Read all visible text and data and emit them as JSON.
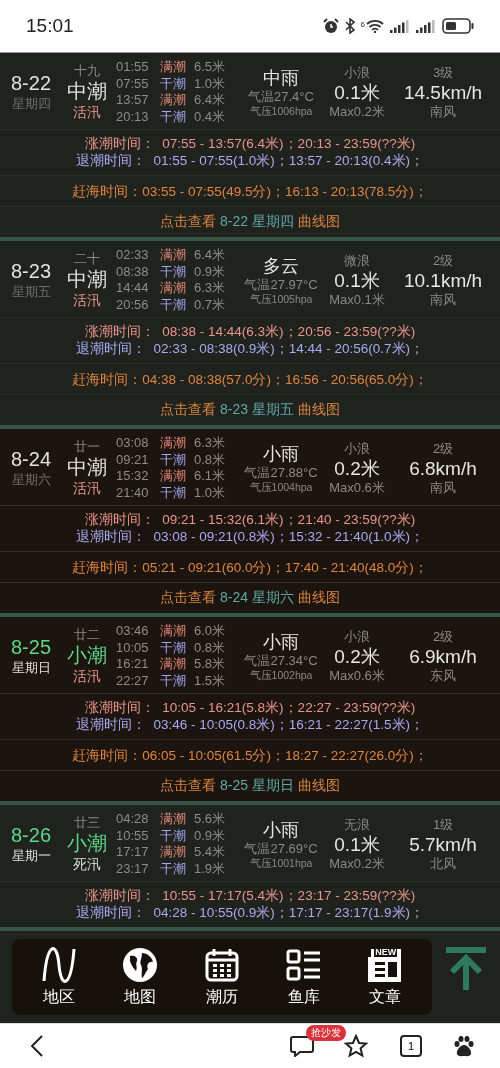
{
  "status_bar": {
    "time": "15:01",
    "network": "6"
  },
  "days": [
    {
      "date": "8-22",
      "weekday": "星期四",
      "weekend": false,
      "lunar": "十九",
      "tide": {
        "name": "中潮",
        "kind": "medium"
      },
      "period": {
        "label": "活汛",
        "kind": "active"
      },
      "tides": [
        {
          "time": "01:55",
          "kind": "high",
          "label": "满潮",
          "height": "6.5米"
        },
        {
          "time": "07:55",
          "kind": "low",
          "label": "干潮",
          "height": "1.0米"
        },
        {
          "time": "13:57",
          "kind": "high",
          "label": "满潮",
          "height": "6.4米"
        },
        {
          "time": "20:13",
          "kind": "low",
          "label": "干潮",
          "height": "0.4米"
        }
      ],
      "weather": "中雨",
      "temperature": "气温27.4°C",
      "pressure": "气压1006hpa",
      "wave_name": "小浪",
      "wave": "0.1米",
      "wave_max": "Max0.2米",
      "wind_level": "3级",
      "wind_speed": "14.5km/h",
      "wind_dir": "南风",
      "rising": "涨潮时间：  07:55 - 13:57(6.4米)；20:13 - 23:59(??米)",
      "falling": "退潮时间：  01:55 - 07:55(1.0米)；13:57 - 20:13(0.4米)；",
      "catch": "赶海时间：03:55 - 07:55(49.5分)；16:13 - 20:13(78.5分)；",
      "link": {
        "prefix": "点击查看",
        "target": "8-22 星期四",
        "suffix": "曲线图"
      }
    },
    {
      "date": "8-23",
      "weekday": "星期五",
      "weekend": false,
      "lunar": "二十",
      "tide": {
        "name": "中潮",
        "kind": "medium"
      },
      "period": {
        "label": "活汛",
        "kind": "active"
      },
      "tides": [
        {
          "time": "02:33",
          "kind": "high",
          "label": "满潮",
          "height": "6.4米"
        },
        {
          "time": "08:38",
          "kind": "low",
          "label": "干潮",
          "height": "0.9米"
        },
        {
          "time": "14:44",
          "kind": "high",
          "label": "满潮",
          "height": "6.3米"
        },
        {
          "time": "20:56",
          "kind": "low",
          "label": "干潮",
          "height": "0.7米"
        }
      ],
      "weather": "多云",
      "temperature": "气温27.97°C",
      "pressure": "气压1005hpa",
      "wave_name": "微浪",
      "wave": "0.1米",
      "wave_max": "Max0.1米",
      "wind_level": "2级",
      "wind_speed": "10.1km/h",
      "wind_dir": "南风",
      "rising": "涨潮时间：  08:38 - 14:44(6.3米)；20:56 - 23:59(??米)",
      "falling": "退潮时间：  02:33 - 08:38(0.9米)；14:44 - 20:56(0.7米)；",
      "catch": "赶海时间：04:38 - 08:38(57.0分)；16:56 - 20:56(65.0分)；",
      "link": {
        "prefix": "点击查看",
        "target": "8-23 星期五",
        "suffix": "曲线图"
      }
    },
    {
      "date": "8-24",
      "weekday": "星期六",
      "weekend": true,
      "lunar": "廿一",
      "tide": {
        "name": "中潮",
        "kind": "medium"
      },
      "period": {
        "label": "活汛",
        "kind": "active"
      },
      "tides": [
        {
          "time": "03:08",
          "kind": "high",
          "label": "满潮",
          "height": "6.3米"
        },
        {
          "time": "09:21",
          "kind": "low",
          "label": "干潮",
          "height": "0.8米"
        },
        {
          "time": "15:32",
          "kind": "high",
          "label": "满潮",
          "height": "6.1米"
        },
        {
          "time": "21:40",
          "kind": "low",
          "label": "干潮",
          "height": "1.0米"
        }
      ],
      "weather": "小雨",
      "temperature": "气温27.88°C",
      "pressure": "气压1004hpa",
      "wave_name": "小浪",
      "wave": "0.2米",
      "wave_max": "Max0.6米",
      "wind_level": "2级",
      "wind_speed": "6.8km/h",
      "wind_dir": "南风",
      "rising": "涨潮时间：  09:21 - 15:32(6.1米)；21:40 - 23:59(??米)",
      "falling": "退潮时间：  03:08 - 09:21(0.8米)；15:32 - 21:40(1.0米)；",
      "catch": "赶海时间：05:21 - 09:21(60.0分)；17:40 - 21:40(48.0分)；",
      "link": {
        "prefix": "点击查看",
        "target": "8-24 星期六",
        "suffix": "曲线图"
      }
    },
    {
      "date": "8-25",
      "weekday": "星期日",
      "weekend": true,
      "lunar": "廿二",
      "tide": {
        "name": "小潮",
        "kind": "small"
      },
      "period": {
        "label": "活汛",
        "kind": "active"
      },
      "tides": [
        {
          "time": "03:46",
          "kind": "high",
          "label": "满潮",
          "height": "6.0米"
        },
        {
          "time": "10:05",
          "kind": "low",
          "label": "干潮",
          "height": "0.8米"
        },
        {
          "time": "16:21",
          "kind": "high",
          "label": "满潮",
          "height": "5.8米"
        },
        {
          "time": "22:27",
          "kind": "low",
          "label": "干潮",
          "height": "1.5米"
        }
      ],
      "weather": "小雨",
      "temperature": "气温27.34°C",
      "pressure": "气压1002hpa",
      "wave_name": "小浪",
      "wave": "0.2米",
      "wave_max": "Max0.6米",
      "wind_level": "2级",
      "wind_speed": "6.9km/h",
      "wind_dir": "东风",
      "rising": "涨潮时间：  10:05 - 16:21(5.8米)；22:27 - 23:59(??米)",
      "falling": "退潮时间：  03:46 - 10:05(0.8米)；16:21 - 22:27(1.5米)；",
      "catch": "赶海时间：06:05 - 10:05(61.5分)；18:27 - 22:27(26.0分)；",
      "link": {
        "prefix": "点击查看",
        "target": "8-25 星期日",
        "suffix": "曲线图"
      }
    },
    {
      "date": "8-26",
      "weekday": "星期一",
      "weekend": false,
      "lunar": "廿三",
      "tide": {
        "name": "小潮",
        "kind": "small"
      },
      "period": {
        "label": "死汛",
        "kind": "dead"
      },
      "tides": [
        {
          "time": "04:28",
          "kind": "high",
          "label": "满潮",
          "height": "5.6米"
        },
        {
          "time": "10:55",
          "kind": "low",
          "label": "干潮",
          "height": "0.9米"
        },
        {
          "time": "17:17",
          "kind": "high",
          "label": "满潮",
          "height": "5.4米"
        },
        {
          "time": "23:17",
          "kind": "low",
          "label": "干潮",
          "height": "1.9米"
        }
      ],
      "weather": "小雨",
      "temperature": "气温27.69°C",
      "pressure": "气压1001hpa",
      "wave_name": "无浪",
      "wave": "0.1米",
      "wave_max": "Max0.2米",
      "wind_level": "1级",
      "wind_speed": "5.7km/h",
      "wind_dir": "北风",
      "rising": "涨潮时间：  10:55 - 17:17(5.4米)；23:17 - 23:59(??米)",
      "falling": "退潮时间：  04:28 - 10:55(0.9米)；17:17 - 23:17(1.9米)；"
    }
  ],
  "nav": [
    {
      "kind": "wave",
      "label": "地区"
    },
    {
      "kind": "globe",
      "label": "地图"
    },
    {
      "kind": "calendar",
      "label": "潮历"
    },
    {
      "kind": "list",
      "label": "鱼库"
    },
    {
      "kind": "news",
      "label": "文章",
      "badge": "NEW"
    }
  ],
  "browser_bar": {
    "comment_badge": "抢沙发",
    "tab_count": "1"
  }
}
